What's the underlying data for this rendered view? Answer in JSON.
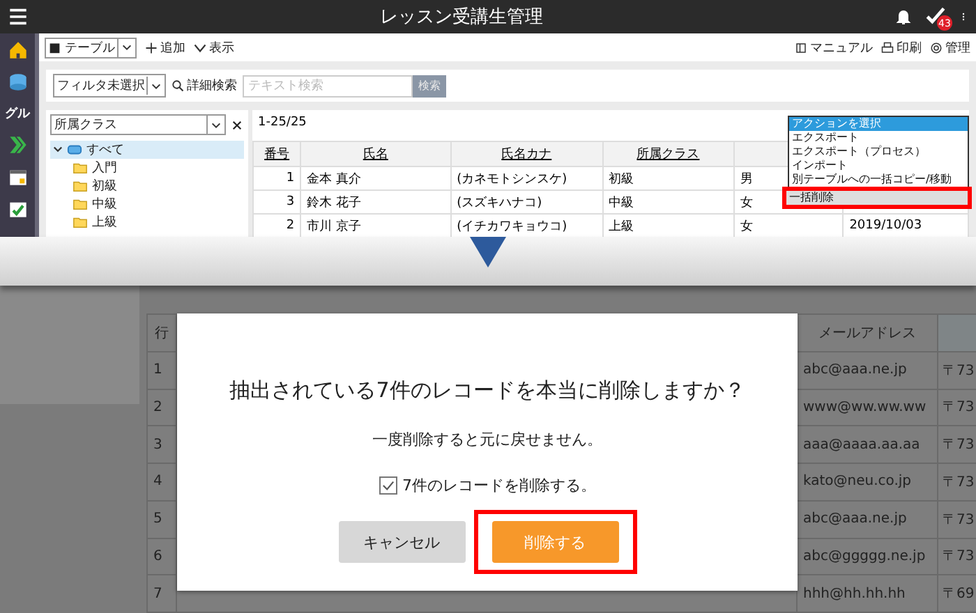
{
  "window": {
    "title": "レッスン受講生管理",
    "badge": "43"
  },
  "rail": {
    "label": "グル"
  },
  "toolbar": {
    "view_select": "■ テーブル",
    "add": "追加",
    "display": "表示",
    "links": [
      "マニュアル",
      "印刷",
      "管理"
    ]
  },
  "filter": {
    "select": "フィルタ未選択",
    "advanced": "詳細検索",
    "placeholder": "テキスト検索",
    "search_button": "検索"
  },
  "tree": {
    "select": "所属クラス",
    "items": [
      {
        "label": "すべて",
        "selected": true,
        "expanded": true,
        "children": [
          {
            "label": "入門",
            "selected": false
          },
          {
            "label": "初級",
            "selected": false
          },
          {
            "label": "中級",
            "selected": false
          },
          {
            "label": "上級",
            "selected": false
          }
        ]
      }
    ]
  },
  "table": {
    "count": "1-25/25",
    "columns": [
      "番号",
      "氏名",
      "氏名カナ",
      "所属クラス"
    ],
    "rows": [
      {
        "cells": [
          "1",
          "金本 真介",
          "(カネモトシンスケ)",
          "初級",
          "男"
        ]
      },
      {
        "cells": [
          "3",
          "鈴木 花子",
          "(スズキハナコ)",
          "中級",
          "女"
        ]
      },
      {
        "cells": [
          "2",
          "市川 京子",
          "(イチカワキョウコ)",
          "上級",
          "女",
          "2019/10/03"
        ]
      }
    ]
  },
  "action_menu": {
    "items": [
      {
        "label": "アクションを選択",
        "selected": true,
        "highlighted": false
      },
      {
        "label": "エクスポート",
        "selected": false,
        "highlighted": false
      },
      {
        "label": "エクスポート（プロセス）",
        "selected": false,
        "highlighted": false
      },
      {
        "label": "インポート",
        "selected": false,
        "highlighted": false
      },
      {
        "label": "別テーブルへの一括コピー/移動",
        "selected": false,
        "highlighted": false
      },
      {
        "label": "一括削除",
        "selected": false,
        "highlighted": true
      }
    ]
  },
  "background_table": {
    "header_number": "行",
    "header_email": "メールアドレス",
    "rows": [
      {
        "number": "1",
        "email": "abc@aaa.ne.jp",
        "postal": "〒73"
      },
      {
        "number": "2",
        "email": "www@ww.ww.ww",
        "postal": "〒73"
      },
      {
        "number": "3",
        "email": "aaa@aaaa.aa.aa",
        "postal": "〒73"
      },
      {
        "number": "4",
        "email": "kato@neu.co.jp",
        "postal": "〒73"
      },
      {
        "number": "5",
        "email": "abc@aaa.ne.jp",
        "postal": "〒73"
      },
      {
        "number": "6",
        "email": "abc@ggggg.ne.jp",
        "postal": "〒73"
      },
      {
        "number": "7",
        "email": "hhh@hh.hh.hh",
        "postal": "〒69"
      }
    ]
  },
  "dialog": {
    "title": "抽出されている7件のレコードを本当に削除しますか？",
    "message": "一度削除すると元に戻せません。",
    "checkbox": {
      "label": "7件のレコードを削除する。",
      "checked": true
    },
    "buttons": [
      {
        "label": "キャンセル",
        "kind": "secondary",
        "highlighted": false
      },
      {
        "label": "削除する",
        "kind": "primary",
        "highlighted": true
      }
    ]
  }
}
